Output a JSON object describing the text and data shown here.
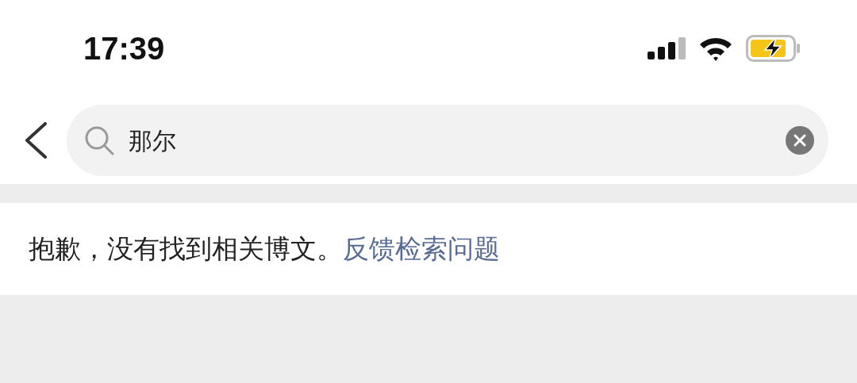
{
  "status_bar": {
    "time": "17:39"
  },
  "search": {
    "value": "那尔"
  },
  "message": {
    "text": "抱歉，没有找到相关博文。",
    "link": "反馈检索问题"
  }
}
